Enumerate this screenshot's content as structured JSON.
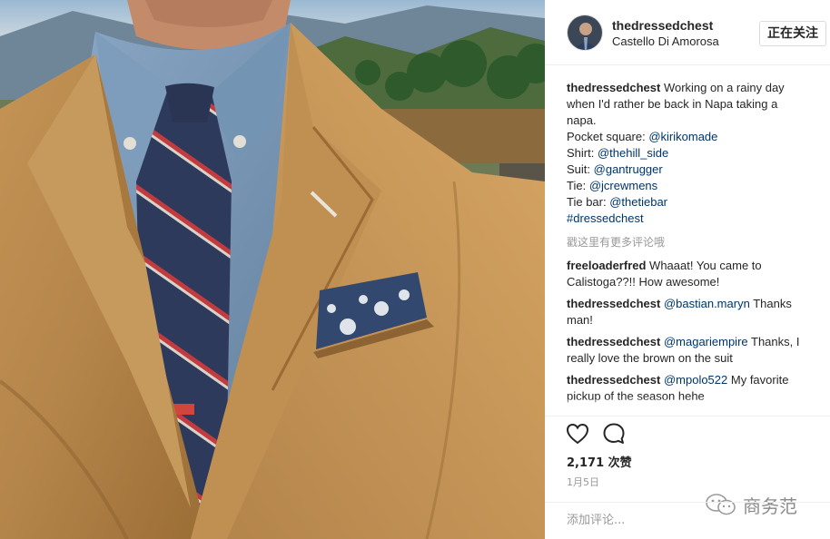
{
  "header": {
    "username": "thedressedchest",
    "location": "Castello Di Amorosa",
    "follow_label": "正在关注"
  },
  "caption": {
    "username": "thedressedchest",
    "line1": "Working on a rainy day",
    "line2": "when I'd rather be back in Napa taking a",
    "line3": "napa.",
    "credits": [
      {
        "label": "Pocket square:",
        "handle": "@kirikomade"
      },
      {
        "label": "Shirt:",
        "handle": "@thehill_side"
      },
      {
        "label": "Suit:",
        "handle": "@gantrugger"
      },
      {
        "label": "Tie:",
        "handle": "@jcrewmens"
      },
      {
        "label": "Tie bar:",
        "handle": "@thetiebar"
      }
    ],
    "hashtag": "#dressedchest"
  },
  "load_more": "戳这里有更多评论哦",
  "comments": [
    {
      "user": "freeloaderfred",
      "line1": "Whaaat! You came to",
      "line2": "Calistoga??!! How awesome!"
    },
    {
      "user": "thedressedchest",
      "mention": "@bastian.maryn",
      "line1": "Thanks",
      "line2": "man!"
    },
    {
      "user": "thedressedchest",
      "mention": "@magariempire",
      "line1": "Thanks, I",
      "line2": "really love the brown on the suit"
    },
    {
      "user": "thedressedchest",
      "mention": "@mpolo522",
      "line1": "My favorite",
      "line2": "pickup of the season hehe"
    }
  ],
  "actions": {
    "like_icon": "heart-outline-icon",
    "comment_icon": "speech-bubble-icon",
    "likes": "2,171 次赞",
    "date": "1月5日"
  },
  "watermark": "商务范",
  "add_comment_placeholder": "添加评论...",
  "colors": {
    "link": "#003569",
    "jacket": "#b98a4e",
    "shirt": "#6d8cab",
    "tie": "#2f3b5e"
  }
}
